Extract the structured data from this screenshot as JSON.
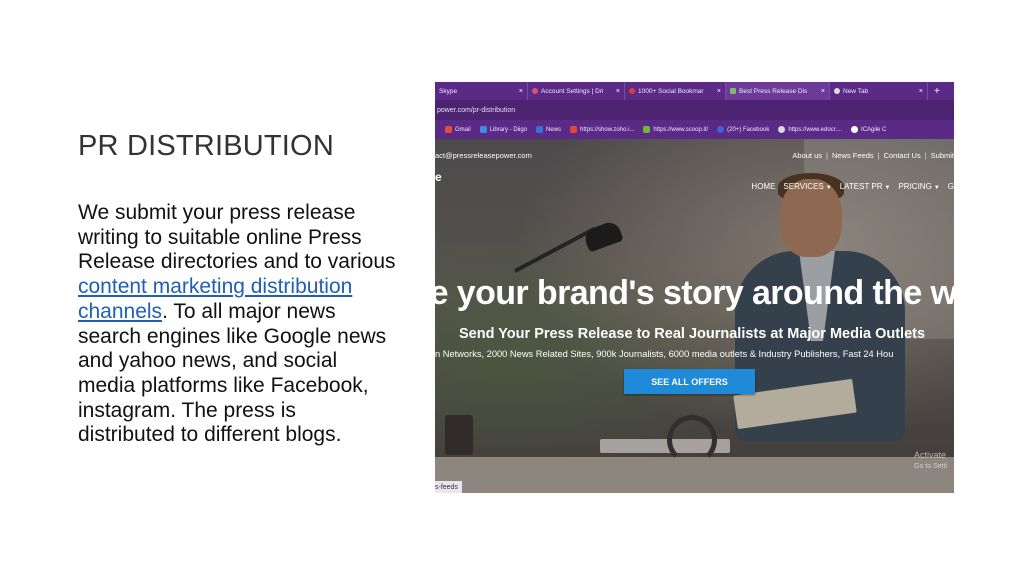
{
  "slide": {
    "title": "PR DISTRIBUTION",
    "body_before_link": "We submit your press release writing to suitable online Press Release directories and to various ",
    "link_text": "content marketing distribution channels",
    "body_after_link": ". To all major news search engines like Google news and yahoo news, and social media platforms like Facebook, instagram. The press is distributed to different blogs."
  },
  "screenshot": {
    "tabs": [
      {
        "label": "Skype",
        "close": "×"
      },
      {
        "label": "Account Settings | Dri",
        "close": "×"
      },
      {
        "label": "1000+ Social Bookmar",
        "close": "×"
      },
      {
        "label": "Best Press Release Dis",
        "close": "×"
      },
      {
        "label": "New Tab",
        "close": "×"
      }
    ],
    "new_tab": "+",
    "url": "power.com/pr-distribution",
    "bookmarks": [
      {
        "label": "Gmail"
      },
      {
        "label": "Library - Diigo"
      },
      {
        "label": "News"
      },
      {
        "label": "https://show.zoho.i..."
      },
      {
        "label": "https://www.scoop.it/"
      },
      {
        "label": "(20+) Facebook"
      },
      {
        "label": "https://www.edocr...."
      },
      {
        "label": "ICAgile C"
      }
    ],
    "site": {
      "contact": "act@pressreleasepower.com",
      "top_links": [
        "About us",
        "|",
        "News Feeds",
        "|",
        "Contact Us",
        "|",
        "Submit"
      ],
      "logo_fragment": "e",
      "nav": [
        {
          "label": "HOME",
          "caret": ""
        },
        {
          "label": "SERVICES",
          "caret": "▼"
        },
        {
          "label": "LATEST PR",
          "caret": "▼"
        },
        {
          "label": "PRICING",
          "caret": "▼"
        },
        {
          "label": "G",
          "caret": ""
        }
      ],
      "headline": "re your brand's story around the wo",
      "subheadline": "Send Your Press Release to Real Journalists at Major Media Outlets",
      "stats": "n Networks, 2000 News Related Sites, 900k Journalists, 6000 media outlets & Industry Publishers, Fast 24 Hou",
      "cta": "SEE ALL OFFERS",
      "watermark_line1": "Activate",
      "watermark_line2": "Go to Setti",
      "status_url": "s-feeds"
    }
  }
}
